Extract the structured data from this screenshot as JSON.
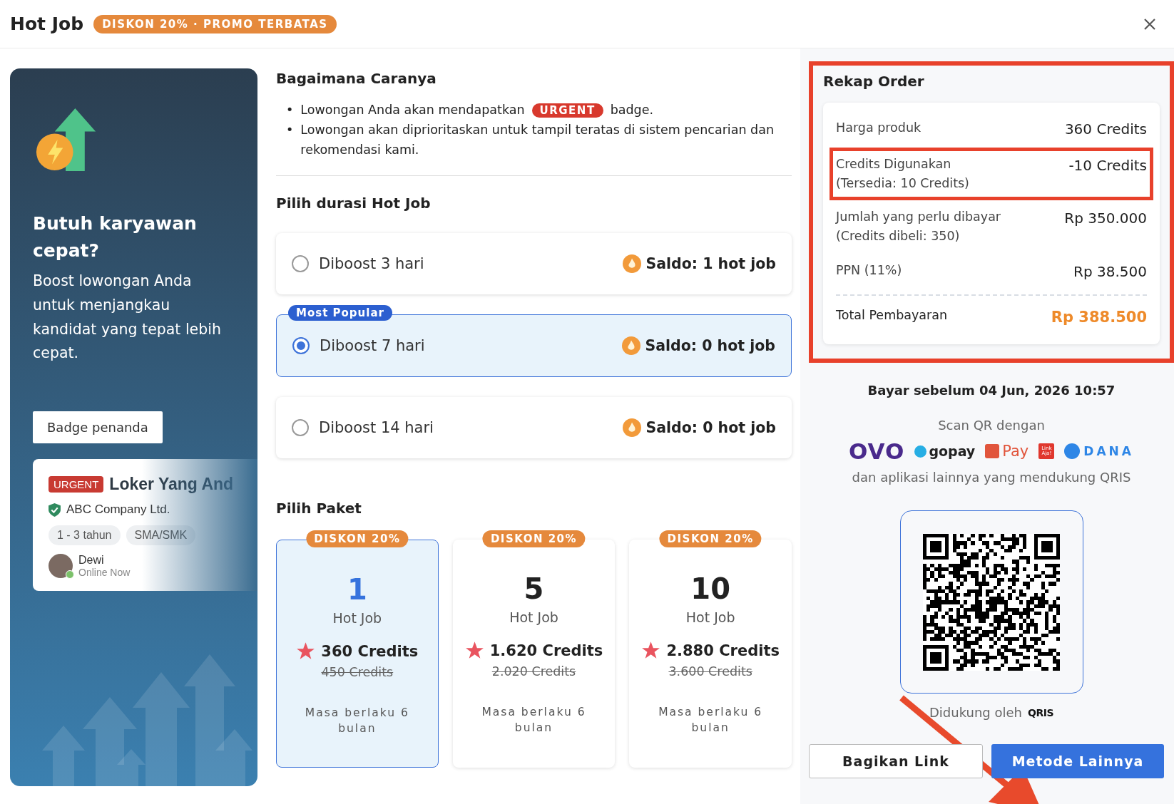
{
  "header": {
    "title": "Hot Job",
    "promo": "DISKON 20% · PROMO TERBATAS"
  },
  "left_panel": {
    "heading": "Butuh karyawan cepat?",
    "text": "Boost lowongan Anda untuk menjangkau kandidat yang tepat lebih cepat.",
    "tooltip": "Badge penanda",
    "job_card": {
      "badge": "URGENT",
      "title": "Loker Yang And",
      "company": "ABC Company Ltd.",
      "verified": true,
      "tags": [
        "1 - 3 tahun",
        "SMA/SMK"
      ],
      "user": "Dewi",
      "status": "Online Now",
      "online": true
    }
  },
  "how_to": {
    "title": "Bagaimana Caranya",
    "bullets": [
      {
        "kind": "badge",
        "marker": "•",
        "before": "Lowongan Anda akan mendapatkan",
        "badge": "URGENT",
        "after": "badge."
      },
      {
        "kind": "text",
        "marker": "•",
        "text": "Lowongan akan diprioritaskan untuk tampil teratas di sistem pencarian dan rekomendasi kami."
      }
    ]
  },
  "duration": {
    "title": "Pilih durasi Hot Job",
    "options": [
      {
        "label": "Diboost 3 hari",
        "saldo": "Saldo: 1 hot job",
        "selected": false
      },
      {
        "label": "Diboost 7 hari",
        "saldo": "Saldo: 0 hot job",
        "selected": true,
        "tag": "Most Popular"
      },
      {
        "label": "Diboost 14 hari",
        "saldo": "Saldo: 0 hot job",
        "selected": false
      }
    ]
  },
  "packages": {
    "title": "Pilih Paket",
    "items": [
      {
        "discount": "DISKON 20%",
        "count": "1",
        "unit": "Hot Job",
        "price": "360 Credits",
        "old_price": "450 Credits",
        "validity": "Masa berlaku 6 bulan",
        "selected": true
      },
      {
        "discount": "DISKON 20%",
        "count": "5",
        "unit": "Hot Job",
        "price": "1.620 Credits",
        "old_price": "2.020 Credits",
        "validity": "Masa berlaku 6 bulan",
        "selected": false
      },
      {
        "discount": "DISKON 20%",
        "count": "10",
        "unit": "Hot Job",
        "price": "2.880 Credits",
        "old_price": "3.600 Credits",
        "validity": "Masa berlaku 6 bulan",
        "selected": false
      }
    ]
  },
  "summary": {
    "title": "Rekap Order",
    "highlighted": true,
    "rows": [
      {
        "label": "Harga produk",
        "note": null,
        "value": "360 Credits",
        "highlighted": false
      },
      {
        "label": "Credits Digunakan",
        "note": "(Tersedia: 10 Credits)",
        "value": "-10 Credits",
        "highlighted": true
      },
      {
        "label": "Jumlah yang perlu dibayar",
        "note": "(Credits dibeli: 350)",
        "value": "Rp 350.000",
        "highlighted": false
      },
      {
        "label": "PPN (11%)",
        "note": null,
        "value": "Rp 38.500",
        "highlighted": false
      }
    ],
    "total": {
      "label": "Total Pembayaran",
      "value": "Rp 388.500"
    }
  },
  "payment": {
    "deadline": "Bayar sebelum 04 Jun, 2026 10:57",
    "scan_text": "Scan QR dengan",
    "wallets": [
      {
        "kind": "ovo",
        "name": "OVO"
      },
      {
        "kind": "gopay",
        "name": "gopay"
      },
      {
        "kind": "spay",
        "name": "Pay"
      },
      {
        "kind": "linkaja",
        "name": "Link Aja!"
      },
      {
        "kind": "dana",
        "name": "DANA"
      }
    ],
    "supported_apps": "dan aplikasi lainnya yang mendukung QRIS",
    "supported_by": "Didukung oleh",
    "qris_logo": "QRIS",
    "buttons": [
      {
        "kind": "secondary",
        "label": "Bagikan Link"
      },
      {
        "kind": "primary",
        "label": "Metode Lainnya"
      }
    ]
  }
}
